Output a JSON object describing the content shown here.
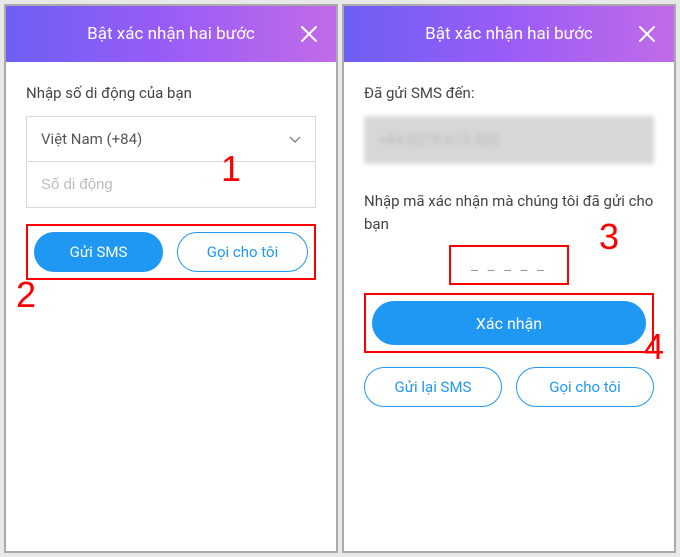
{
  "left": {
    "header": {
      "title": "Bật xác nhận hai bước"
    },
    "prompt": "Nhập số di động của bạn",
    "country_select": "Việt Nam (+84)",
    "phone_placeholder": "Số di động",
    "btn_sms": "Gửi SMS",
    "btn_call": "Gọi cho tôi",
    "annotations": {
      "one": "1",
      "two": "2"
    }
  },
  "right": {
    "header": {
      "title": "Bật xác nhận hai bước"
    },
    "sent_label": "Đã gửi SMS đến:",
    "phone_display": "+84 0275 613 305",
    "instruction": "Nhập mã xác nhận mà chúng tôi đã gửi cho bạn",
    "code_placeholder": "_ _ _ _ _",
    "btn_confirm": "Xác nhận",
    "btn_resend": "Gửi lại SMS",
    "btn_call": "Gọi cho tôi",
    "annotations": {
      "three": "3",
      "four": "4"
    }
  }
}
